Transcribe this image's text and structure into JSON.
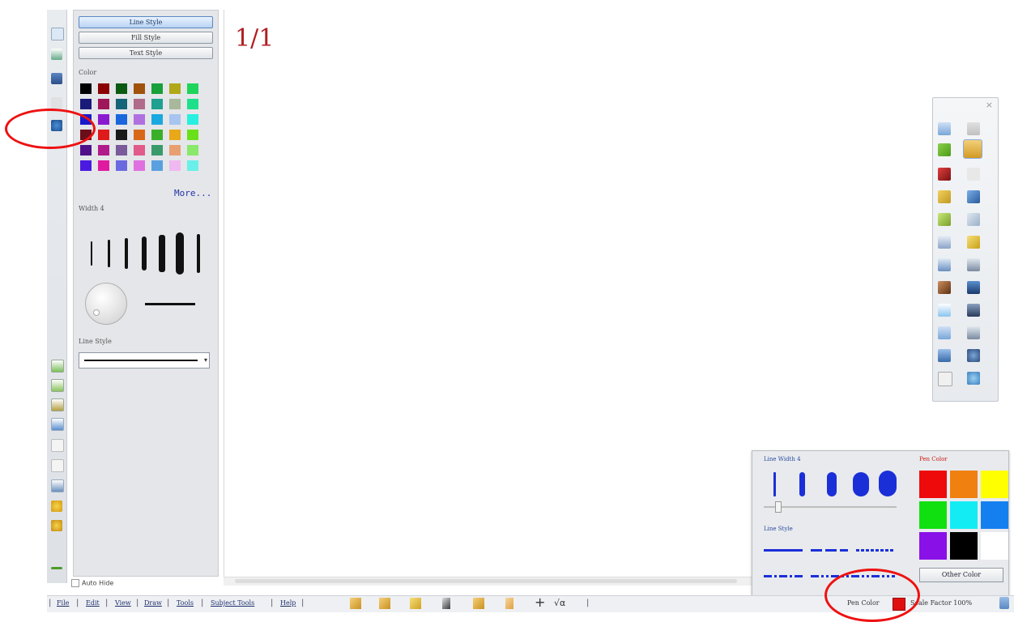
{
  "style_panel": {
    "tabs": [
      "Line Style",
      "Fill Style",
      "Text Style"
    ],
    "color_label": "Color",
    "colors": [
      [
        "#000000",
        "#8b0000",
        "#0b5a12",
        "#a0520b",
        "#18a03a",
        "#b0a818",
        "#1fd45a"
      ],
      [
        "#1a1a7a",
        "#a0165a",
        "#156478",
        "#b06a8a",
        "#1fa090",
        "#a8b89a",
        "#1ee08a"
      ],
      [
        "#1a1acc",
        "#8a1ad0",
        "#1a66dd",
        "#b070e0",
        "#1aa8e0",
        "#a8c4f0",
        "#28f0e0"
      ],
      [
        "#6a0e1a",
        "#e01a1a",
        "#1a1a1a",
        "#d86818",
        "#3ab02a",
        "#e8a818",
        "#6ae01a"
      ],
      [
        "#50108a",
        "#b01a8a",
        "#7a5a9a",
        "#e05a8a",
        "#3a9a6a",
        "#e8a070",
        "#8ae86a"
      ],
      [
        "#4a1ae0",
        "#e01aa0",
        "#6a6ae0",
        "#e070e0",
        "#5aa0e0",
        "#f0b8f0",
        "#6af0e8"
      ]
    ],
    "more_label": "More...",
    "width_label": "Width 4",
    "linestyle_label": "Line Style",
    "autohide_label": "Auto Hide"
  },
  "canvas": {
    "page_indicator": "1/1"
  },
  "pen_popup": {
    "line_width_label": "Line Width 4",
    "line_style_label": "Line Style",
    "pen_color_label": "Pen Color",
    "colors": [
      "#ee0a0a",
      "#f08010",
      "#ffff00",
      "#10e010",
      "#14ecf4",
      "#1480f0",
      "#8a10e8",
      "#000000",
      "#ffffff"
    ],
    "other_color_label": "Other Color"
  },
  "menubar": {
    "items": [
      "File",
      "Edit",
      "View",
      "Draw",
      "Tools",
      "Subject Tools",
      "Help"
    ],
    "separator": "|",
    "pen_color_label": "Pen Color",
    "pen_color": "#e01010",
    "scale_label": "Scale Factor 100%"
  },
  "accent_colors": {
    "annotation_ring": "#ee1111",
    "page_indicator": "#b01d22"
  }
}
